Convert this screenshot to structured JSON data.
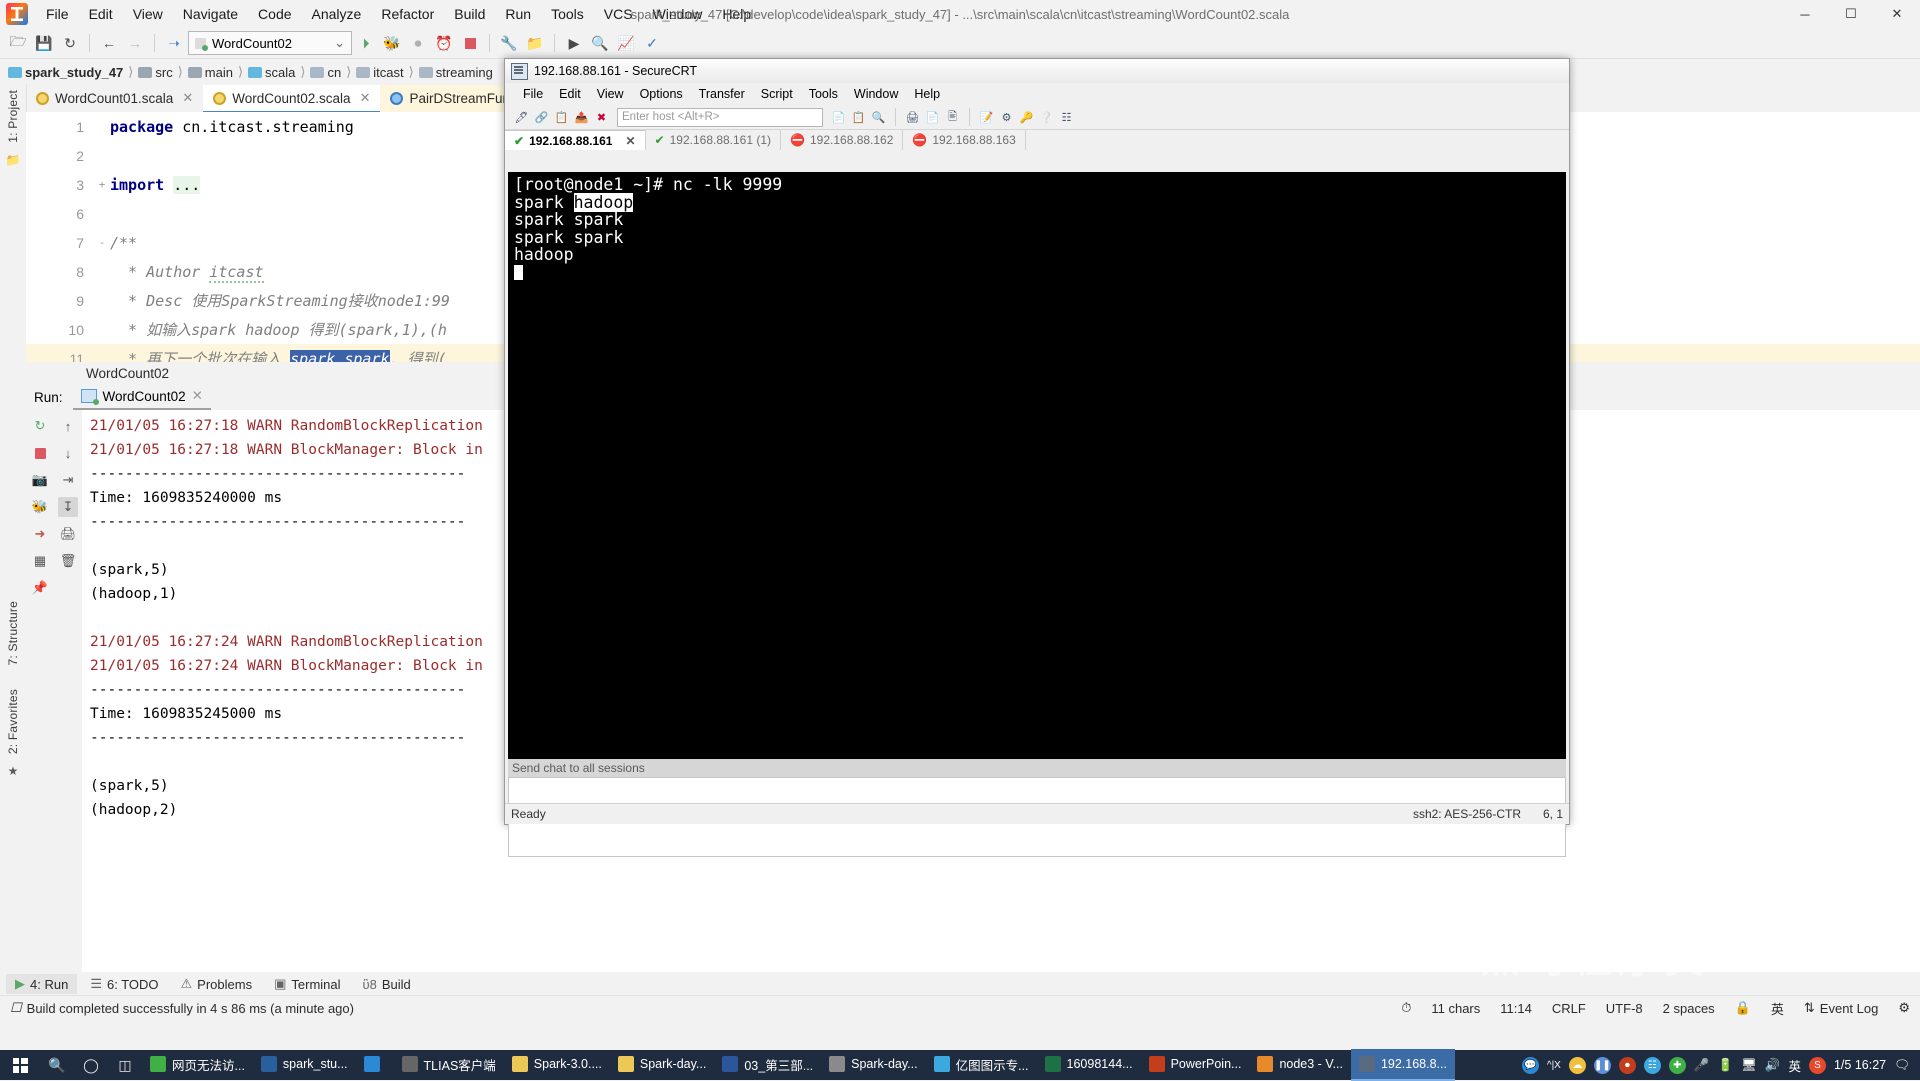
{
  "ide": {
    "window_title": "spark_study_47 [C:\\develop\\code\\idea\\spark_study_47] - ...\\src\\main\\scala\\cn\\itcast\\streaming\\WordCount02.scala",
    "menu": [
      "File",
      "Edit",
      "View",
      "Navigate",
      "Code",
      "Analyze",
      "Refactor",
      "Build",
      "Run",
      "Tools",
      "VCS",
      "Window",
      "Help"
    ],
    "window_buttons": {
      "minimize": "─",
      "maximize": "☐",
      "close": "✕"
    },
    "toolbar": {
      "open_icon": "open-folder-icon",
      "save_icon": "save-icon",
      "sync_icon": "sync-icon",
      "back_icon": "back-arrow-icon",
      "forward_icon": "forward-arrow-icon",
      "revert_icon": "revert-icon",
      "run_config": "WordCount02",
      "chevron": "⌄",
      "run_icon": "run-icon",
      "debug_icon": "debug-icon",
      "coverage_icon": "coverage-run-icon",
      "profile_icon": "profile-icon",
      "stop_icon": "stop-icon",
      "settings_icon": "wrench-icon",
      "project-structure_icon": "project-structure-icon",
      "terminal_icon": "terminal-icon",
      "search_icon": "search-everywhere-icon",
      "monitor_icon": "activity-monitor-icon",
      "check_icon": "check-circle-icon"
    },
    "breadcrumb": [
      "spark_study_47",
      "src",
      "main",
      "scala",
      "cn",
      "itcast",
      "streaming"
    ],
    "editor_tabs": [
      {
        "label": "WordCount01.scala",
        "active": false,
        "closable": true
      },
      {
        "label": "WordCount02.scala",
        "active": true,
        "closable": true
      },
      {
        "label": "PairDStreamFuncti",
        "active": false,
        "closable": false
      }
    ],
    "left_rail": [
      "1: Project",
      "7: Structure",
      "2: Favorites"
    ],
    "code_lines": [
      {
        "num": "1",
        "fold": "",
        "parts": [
          {
            "t": "package ",
            "c": "kw"
          },
          {
            "t": "cn.itcast.streaming",
            "c": ""
          }
        ]
      },
      {
        "num": "2",
        "fold": "",
        "parts": []
      },
      {
        "num": "3",
        "fold": "+",
        "parts": [
          {
            "t": "import ",
            "c": "kw"
          },
          {
            "t": "...",
            "c": "imp"
          }
        ]
      },
      {
        "num": "6",
        "fold": "",
        "parts": []
      },
      {
        "num": "7",
        "fold": "-",
        "parts": [
          {
            "t": "/**",
            "c": "cmt"
          }
        ]
      },
      {
        "num": "8",
        "fold": "",
        "parts": [
          {
            "t": "  * Author ",
            "c": "cmt"
          },
          {
            "t": "itcast",
            "c": "cmt wavy"
          }
        ]
      },
      {
        "num": "9",
        "fold": "",
        "parts": [
          {
            "t": "  * Desc 使用SparkStreaming接收node1:99",
            "c": "cmt"
          }
        ]
      },
      {
        "num": "10",
        "fold": "",
        "parts": [
          {
            "t": "  * 如输入spark hadoop 得到(spark,1),(h",
            "c": "cmt"
          }
        ]
      },
      {
        "num": "11",
        "fold": "",
        "highlight": true,
        "parts": [
          {
            "t": "  * 再下一个批次在输入 ",
            "c": "cmt"
          },
          {
            "t": "spark spark",
            "c": "cmt sel"
          },
          {
            "t": ", 得到(",
            "c": "cmt"
          }
        ]
      }
    ],
    "hint_bar": "WordCount02",
    "run_panel": {
      "label": "Run:",
      "tab": "WordCount02",
      "tab_close": "✕",
      "tools_left": [
        "rerun-icon",
        "stop-icon",
        "camera-icon",
        "debug-attach-icon",
        "export-icon",
        "layout-icon",
        "pin-icon"
      ],
      "tools_right": [
        "scroll-up-icon",
        "scroll-down-icon",
        "soft-wrap-icon",
        "scroll-to-end-icon",
        "print-icon",
        "trash-icon"
      ],
      "console_lines": [
        {
          "text": "21/01/05 16:27:18 WARN RandomBlockReplication",
          "cls": "warn"
        },
        {
          "text": "21/01/05 16:27:18 WARN BlockManager: Block in",
          "cls": "warn"
        },
        {
          "text": "-------------------------------------------",
          "cls": ""
        },
        {
          "text": "Time: 1609835240000 ms",
          "cls": ""
        },
        {
          "text": "-------------------------------------------",
          "cls": ""
        },
        {
          "text": "",
          "cls": ""
        },
        {
          "text": "(spark,5)",
          "cls": ""
        },
        {
          "text": "(hadoop,1)",
          "cls": ""
        },
        {
          "text": "",
          "cls": ""
        },
        {
          "text": "21/01/05 16:27:24 WARN RandomBlockReplication",
          "cls": "warn"
        },
        {
          "text": "21/01/05 16:27:24 WARN BlockManager: Block in",
          "cls": "warn"
        },
        {
          "text": "-------------------------------------------",
          "cls": ""
        },
        {
          "text": "Time: 1609835245000 ms",
          "cls": ""
        },
        {
          "text": "-------------------------------------------",
          "cls": ""
        },
        {
          "text": "",
          "cls": ""
        },
        {
          "text": "(spark,5)",
          "cls": ""
        },
        {
          "text": "(hadoop,2)",
          "cls": ""
        }
      ]
    },
    "bottom_tool_buttons": [
      {
        "icon": "run-triangle-icon",
        "label": "4: Run",
        "active": true
      },
      {
        "icon": "todo-icon",
        "label": "6: TODO",
        "active": false
      },
      {
        "icon": "problems-icon",
        "label": "Problems",
        "active": false
      },
      {
        "icon": "terminal-icon",
        "label": "Terminal",
        "active": false
      },
      {
        "icon": "build-hammer-icon",
        "label": "Build",
        "active": false
      }
    ],
    "status_bar": {
      "build_message": "Build completed successfully in 4 s 86 ms (a minute ago)",
      "build_icon": "build-status-icon",
      "chars": "11 chars",
      "caret": "11:14",
      "line_sep": "CRLF",
      "encoding": "UTF-8",
      "indent": "2 spaces",
      "event_log": "Event Log",
      "gear_icon": "gear-icon",
      "lock_icon": "lock-icon",
      "ime": "英",
      "inspection_icon": "inspection-gauge-icon"
    }
  },
  "securecrt": {
    "title": "192.168.88.161 - SecureCRT",
    "title_icon": "securecrt-icon",
    "menu": [
      "File",
      "Edit",
      "View",
      "Options",
      "Transfer",
      "Script",
      "Tools",
      "Window",
      "Help"
    ],
    "toolbar_icons": [
      "new-session-icon",
      "connect-icon",
      "clone-session-icon",
      "connect-sftp-icon",
      "disconnect-icon"
    ],
    "host_placeholder": "Enter host <Alt+R>",
    "toolbar_icons2": [
      "copy-icon",
      "paste-icon",
      "find-icon",
      "print-icon",
      "log-session-icon",
      "print-screen-icon",
      "session-options-icon",
      "global-options-icon",
      "key-icon",
      "help-icon",
      "tile-icon"
    ],
    "session_tabs": [
      {
        "label": "192.168.88.161",
        "state": "connected",
        "active": true,
        "close": "✕"
      },
      {
        "label": "192.168.88.161 (1)",
        "state": "connected",
        "active": false
      },
      {
        "label": "192.168.88.162",
        "state": "disconnected",
        "active": false
      },
      {
        "label": "192.168.88.163",
        "state": "disconnected",
        "active": false
      }
    ],
    "terminal_lines": [
      {
        "text": "[root@node1 ~]# nc -lk 9999",
        "inverse": ""
      },
      {
        "pre": "spark ",
        "inverse": "hadoop",
        "post": ""
      },
      {
        "text": "spark spark",
        "inverse": ""
      },
      {
        "text": "spark spark",
        "inverse": ""
      },
      {
        "text": "hadoop",
        "inverse": ""
      }
    ],
    "chat_placeholder": "Send chat to all sessions",
    "status": {
      "ready": "Ready",
      "ssh": "ssh2: AES-256-CTR",
      "pos": "6, 1"
    }
  },
  "taskbar": {
    "start_icon": "windows-start-icon",
    "system_icons": [
      "search-icon",
      "cortana-icon",
      "task-view-icon"
    ],
    "items": [
      {
        "label": "网页无法访...",
        "icon": "browser-icon",
        "color": "#3faf46",
        "active": false
      },
      {
        "label": "spark_stu...",
        "icon": "intellij-idea-icon",
        "color": "#2a5f9e",
        "active": false
      },
      {
        "label": "",
        "icon": "wechat-icon",
        "color": "#2b8ad6",
        "active": false
      },
      {
        "label": "TLIAS客户端",
        "icon": "tlias-icon",
        "color": "#666666",
        "active": false
      },
      {
        "label": "Spark-3.0....",
        "icon": "folder-icon",
        "color": "#ecc857",
        "active": false
      },
      {
        "label": "Spark-day...",
        "icon": "folder-icon",
        "color": "#ecc857",
        "active": false
      },
      {
        "label": "03_第三部...",
        "icon": "word-icon",
        "color": "#2b579a",
        "active": false
      },
      {
        "label": "Spark-day...",
        "icon": "text-icon",
        "color": "#8a8a8a",
        "active": false
      },
      {
        "label": "亿图图示专...",
        "icon": "edraw-icon",
        "color": "#3da7e0",
        "active": false
      },
      {
        "label": "16098144...",
        "icon": "excel-icon",
        "color": "#1e7145",
        "active": false
      },
      {
        "label": "PowerPoin...",
        "icon": "powerpoint-icon",
        "color": "#c43e1c",
        "active": false
      },
      {
        "label": "node3 - V...",
        "icon": "vmware-icon",
        "color": "#e88a2a",
        "active": false
      },
      {
        "label": "192.168.8...",
        "icon": "securecrt-icon",
        "color": "#5a6b80",
        "active": true
      }
    ],
    "tray_icons": [
      "ime-bubble-icon",
      "input-method-icon",
      "cloud-icon",
      "pause-icon",
      "recorder-icon",
      "drive-icon",
      "plus-icon",
      "mic-icon",
      "battery-icon",
      "network-icon",
      "volume-icon"
    ],
    "ime": "英",
    "sogou_icon": "sogou-icon",
    "clock": "1/5 16:27",
    "notification_icon": "notification-icon"
  },
  "watermark": "黑马程序员"
}
